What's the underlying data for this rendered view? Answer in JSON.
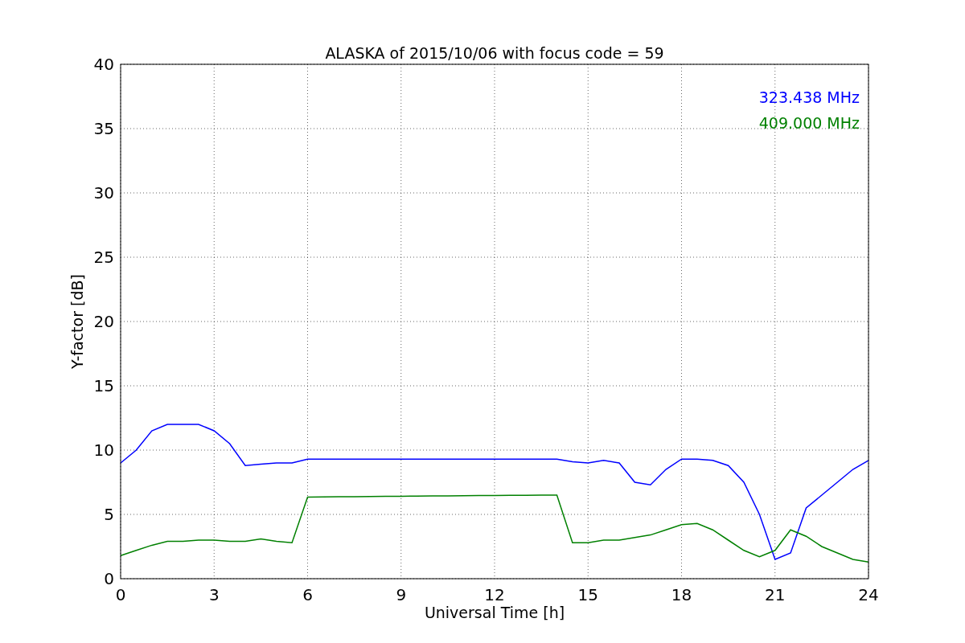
{
  "figure": {
    "chart_data": {
      "type": "line",
      "title": "ALASKA of 2015/10/06 with focus code = 59",
      "xlabel": "Universal Time [h]",
      "ylabel": "Y-factor [dB]",
      "x": [
        0,
        0.5,
        1,
        1.5,
        2,
        2.5,
        3,
        3.5,
        4,
        4.5,
        5,
        5.5,
        6,
        6.5,
        7,
        7.5,
        8,
        8.5,
        9,
        9.5,
        10,
        10.5,
        11,
        11.5,
        12,
        12.5,
        13,
        13.5,
        14,
        14.5,
        15,
        15.5,
        16,
        16.5,
        17,
        17.5,
        18,
        18.5,
        19,
        19.5,
        20,
        20.5,
        21,
        21.5,
        22,
        22.5,
        23,
        23.5,
        24
      ],
      "series": [
        {
          "name": "323.438 MHz",
          "color": "#0000ff",
          "values": [
            9.0,
            10.0,
            11.5,
            12.0,
            12.0,
            12.0,
            11.5,
            10.5,
            8.8,
            8.9,
            9.0,
            9.0,
            9.3,
            9.3,
            9.3,
            9.3,
            9.3,
            9.3,
            9.3,
            9.3,
            9.3,
            9.3,
            9.3,
            9.3,
            9.3,
            9.3,
            9.3,
            9.3,
            9.3,
            9.1,
            9.0,
            9.2,
            9.0,
            7.5,
            7.3,
            8.5,
            9.3,
            9.3,
            9.2,
            8.8,
            7.5,
            5.0,
            1.5,
            2.0,
            5.5,
            6.5,
            7.5,
            8.5,
            9.2
          ]
        },
        {
          "name": "409.000 MHz",
          "color": "#008000",
          "values": [
            1.8,
            2.2,
            2.6,
            2.9,
            2.9,
            3.0,
            3.0,
            2.9,
            2.9,
            3.1,
            2.9,
            2.8,
            6.35,
            6.36,
            6.37,
            6.38,
            6.39,
            6.4,
            6.41,
            6.42,
            6.43,
            6.44,
            6.45,
            6.46,
            6.47,
            6.48,
            6.49,
            6.5,
            6.5,
            2.8,
            2.8,
            3.0,
            3.0,
            3.2,
            3.4,
            3.8,
            4.2,
            4.3,
            3.8,
            3.0,
            2.2,
            1.7,
            2.2,
            3.8,
            3.3,
            2.5,
            2.0,
            1.5,
            1.3
          ]
        }
      ],
      "xlim": [
        0,
        24
      ],
      "ylim": [
        0,
        40
      ],
      "xticks": [
        0,
        3,
        6,
        9,
        12,
        15,
        18,
        21,
        24
      ],
      "yticks": [
        0,
        5,
        10,
        15,
        20,
        25,
        30,
        35,
        40
      ],
      "grid": true
    }
  }
}
